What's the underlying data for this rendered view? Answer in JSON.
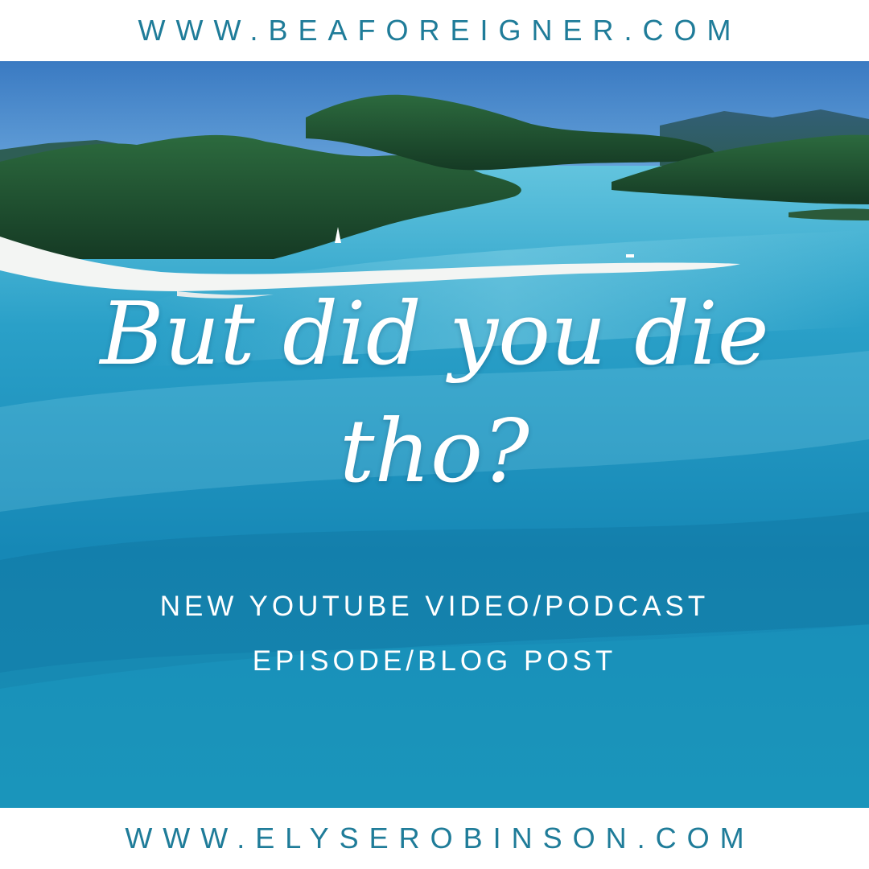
{
  "header": {
    "url": "WWW.BEAFOREIGNER.COM"
  },
  "image": {
    "icon": "aerial-beach-photo",
    "colors": {
      "sky": "#3f7fc6",
      "water_light": "#5cc6df",
      "water_mid": "#1d93bd",
      "water_deep": "#0f6f9c",
      "hills": "#1f4a2e",
      "sand": "#f2f4f2"
    }
  },
  "headline": {
    "line1": "But did you die",
    "line2": "tho?"
  },
  "subtitle": {
    "line1": "NEW YOUTUBE VIDEO/PODCAST",
    "line2": "EPISODE/BLOG POST"
  },
  "footer": {
    "url": "WWW.ELYSEROBINSON.COM"
  }
}
